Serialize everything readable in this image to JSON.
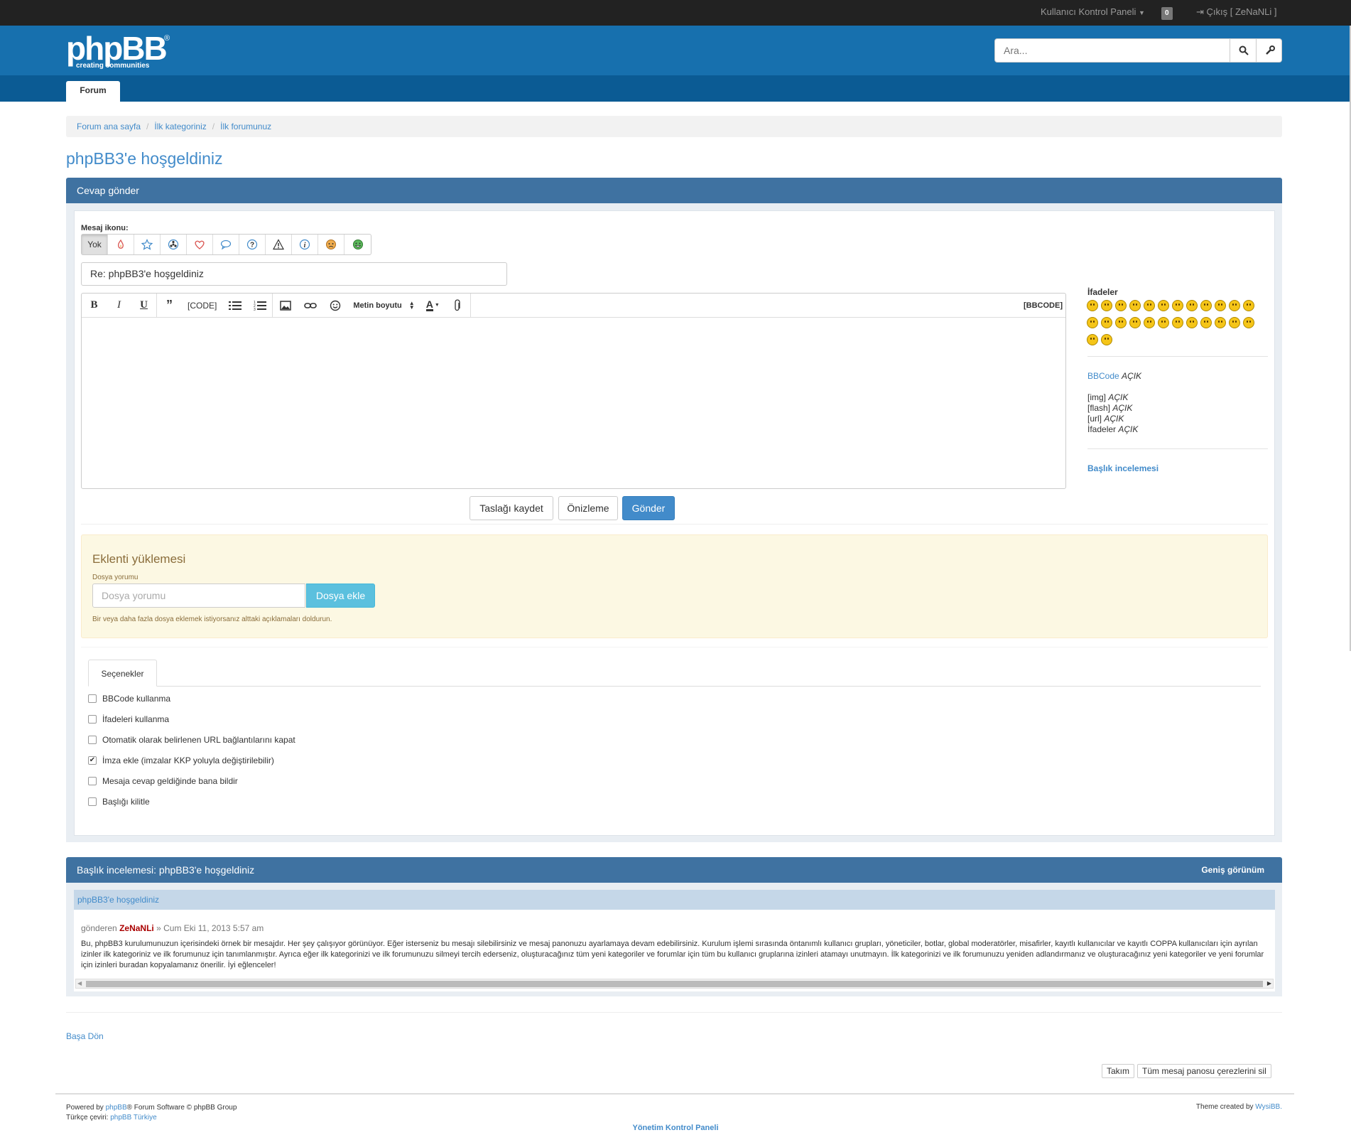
{
  "topbar": {
    "user_panel": "Kullanıcı Kontrol Paneli",
    "notifications_count": "0",
    "logout": "Çıkış [ ZeNaNLi ]"
  },
  "header": {
    "logo_text": "phpBB",
    "logo_tagline": "creating communities",
    "logo_reg": "®",
    "search_placeholder": "Ara...",
    "nav_tab": "Forum"
  },
  "breadcrumb": [
    "Forum ana sayfa",
    "İlk kategoriniz",
    "İlk forumunuz"
  ],
  "page_title": "phpBB3'e hoşgeldiniz",
  "reply_panel": {
    "title": "Cevap gönder",
    "message_icon_label": "Mesaj ikonu:",
    "icon_none": "Yok",
    "subject_value": "Re: phpBB3'e hoşgeldiniz",
    "toolbar": {
      "bold": "B",
      "italic": "I",
      "underline": "U",
      "quote": "”",
      "code": "[CODE]",
      "font_size": "Metin boyutu",
      "color": "A",
      "bbcode_toggle": "[BBCODE]"
    },
    "buttons": {
      "save": "Taslağı kaydet",
      "preview": "Önizleme",
      "submit": "Gönder"
    }
  },
  "sidebar": {
    "smilies_title": "İfadeler",
    "smiley_count": 26,
    "bbcode_link": "BBCode",
    "bbcode_status": "AÇIK",
    "img": "[img]",
    "img_status": "AÇIK",
    "flash": "[flash]",
    "flash_status": "AÇIK",
    "url": "[url]",
    "url_status": "AÇIK",
    "smilies": "İfadeler",
    "smilies_status": "AÇIK",
    "topic_review_link": "Başlık incelemesi"
  },
  "attachment": {
    "title": "Eklenti yüklemesi",
    "comment_label": "Dosya yorumu",
    "comment_placeholder": "Dosya yorumu",
    "add_button": "Dosya ekle",
    "hint": "Bir veya daha fazla dosya eklemek istiyorsanız alttaki açıklamaları doldurun."
  },
  "options": {
    "tab": "Seçenekler",
    "items": [
      {
        "label": "BBCode kullanma",
        "checked": false
      },
      {
        "label": "İfadeleri kullanma",
        "checked": false
      },
      {
        "label": "Otomatik olarak belirlenen URL bağlantılarını kapat",
        "checked": false
      },
      {
        "label": "İmza ekle (imzalar KKP yoluyla değiştirilebilir)",
        "checked": true
      },
      {
        "label": "Mesaja cevap geldiğinde bana bildir",
        "checked": false
      },
      {
        "label": "Başlığı kilitle",
        "checked": false
      }
    ]
  },
  "review": {
    "title": "Başlık incelemesi: phpBB3'e hoşgeldiniz",
    "expand": "Geniş görünüm",
    "post_title": "phpBB3'e hoşgeldiniz",
    "by": "gönderen",
    "author": "ZeNaNLi",
    "date": "» Cum Eki 11, 2013 5:57 am",
    "body": "Bu, phpBB3 kurulumunuzun içerisindeki örnek bir mesajdır. Her şey çalışıyor görünüyor. Eğer isterseniz bu mesajı silebilirsiniz ve mesaj panonuzu ayarlamaya devam edebilirsiniz. Kurulum işlemi sırasında öntanımlı kullanıcı grupları, yöneticiler, botlar, global moderatörler, misafirler, kayıtlı kullanıcılar ve kayıtlı COPPA kullanıcıları için ayrılan izinler ilk kategoriniz ve ilk forumunuz için tanımlanmıştır. Ayrıca eğer ilk kategorinizi ve ilk forumunuzu silmeyi tercih ederseniz, oluşturacağınız tüm yeni kategoriler ve forumlar için tüm bu kullanıcı gruplarına izinleri atamayı unutmayın. İlk kategorinizi ve ilk forumunuzu yeniden adlandırmanız ve oluşturacağınız yeni kategoriler ve yeni forumlar için izinleri buradan kopyalamanız önerilir. İyi eğlenceler!"
  },
  "footer": {
    "back_to_top": "Başa Dön",
    "team": "Takım",
    "delete_cookies": "Tüm mesaj panosu çerezlerini sil",
    "powered_prefix": "Powered by",
    "phpbb_link": "phpBB",
    "powered_suffix": "® Forum Software © phpBB Group",
    "translation_prefix": "Türkçe çeviri:",
    "translation_link": "phpBB Türkiye",
    "theme_prefix": "Theme created by",
    "theme_link": "WysiBB.",
    "acp": "Yönetim Kontrol Paneli"
  }
}
